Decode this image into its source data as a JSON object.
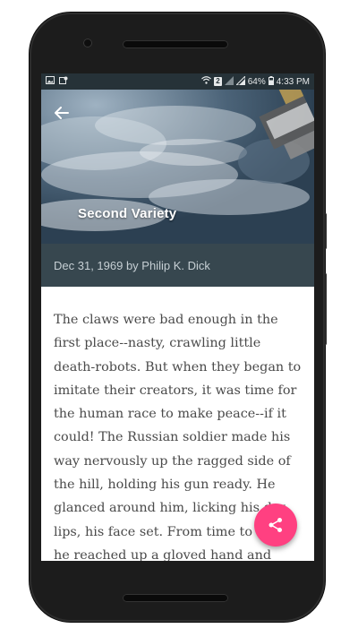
{
  "status_bar": {
    "battery": "64%",
    "time": "4:33 PM",
    "sim_badge": "2",
    "left_icons": [
      "image-icon",
      "notification-icon"
    ],
    "right_icons": [
      "wifi-icon",
      "signal-icon",
      "signal-icon",
      "battery-icon"
    ]
  },
  "header": {
    "back_icon": "arrow-left-icon",
    "title": "Second Variety"
  },
  "meta": {
    "byline": "Dec 31, 1969 by Philip K. Dick"
  },
  "article": {
    "body": "The claws were bad enough in the first place--nasty, crawling little death-robots. But when they began to imitate their creators, it was time for the human race to make peace--if it could! The Russian soldier made his way nervously up the ragged side of the hill, holding his gun ready. He glanced around him, licking his dry lips, his face set. From time to time he reached up a gloved hand and wiped"
  },
  "fab": {
    "icon": "share-icon",
    "color": "#ff4081"
  },
  "colors": {
    "status_bar": "#263238",
    "meta_bar": "#37474f",
    "accent": "#ff4081"
  }
}
